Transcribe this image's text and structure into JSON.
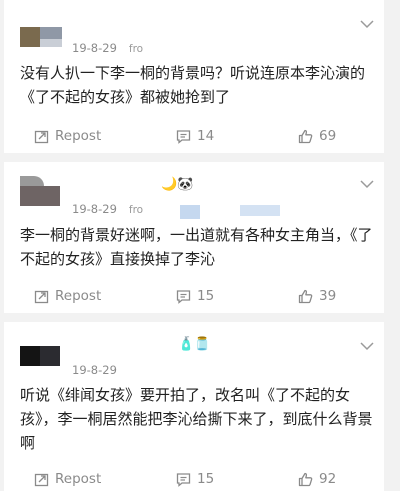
{
  "posts": [
    {
      "date": "19-8-29",
      "source": "fro",
      "text": "没有人扒一下李一桐的背景吗？听说连原本李沁演的《了不起的女孩》都被她抢到了",
      "repost_label": "Repost",
      "comments": "14",
      "likes": "69"
    },
    {
      "date": "19-8-29",
      "source": "fro",
      "emojis": "🌙🐼",
      "text": "李一桐的背景好迷啊，一出道就有各种女主角当，《了不起的女孩》直接换掉了李沁",
      "repost_label": "Repost",
      "comments": "15",
      "likes": "39"
    },
    {
      "date": "19-8-29",
      "emojis": "🧴🫙",
      "text": "听说《绯闻女孩》要开拍了，改名叫《了不起的女孩》，李一桐居然能把李沁给撕下来了，到底什么背景啊",
      "repost_label": "Repost",
      "comments": "15",
      "likes": "92"
    }
  ],
  "icons": {
    "expand": "chevron-down-icon",
    "repost": "repost-icon",
    "comment": "comment-icon",
    "like": "thumbs-up-icon"
  },
  "colors": {
    "page_bg": "#f2f2f2",
    "card_bg": "#ffffff",
    "text": "#222222",
    "muted": "#8a8a8a"
  }
}
